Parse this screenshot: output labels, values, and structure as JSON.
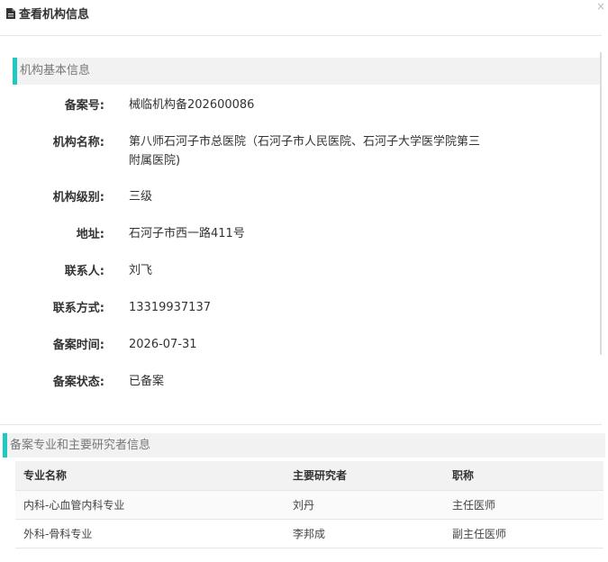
{
  "header": {
    "title": "查看机构信息",
    "close": "×"
  },
  "basic": {
    "section_title": "机构基本信息",
    "fields": [
      {
        "label": "备案号:",
        "value": "械临机构备202600086"
      },
      {
        "label": "机构名称:",
        "value": "第八师石河子市总医院（石河子市人民医院、石河子大学医学院第三附属医院)"
      },
      {
        "label": "机构级别:",
        "value": "三级"
      },
      {
        "label": "地址:",
        "value": "石河子市西一路411号"
      },
      {
        "label": "联系人:",
        "value": "刘飞"
      },
      {
        "label": "联系方式:",
        "value": "13319937137"
      },
      {
        "label": "备案时间:",
        "value": "2026-07-31"
      },
      {
        "label": "备案状态:",
        "value": "已备案"
      }
    ]
  },
  "specialty": {
    "section_title": "备案专业和主要研究者信息",
    "columns": [
      "专业名称",
      "主要研究者",
      "职称"
    ],
    "rows": [
      [
        "内科-心血管内科专业",
        "刘丹",
        "主任医师"
      ],
      [
        "外科-骨科专业",
        "李邦成",
        "副主任医师"
      ]
    ]
  }
}
